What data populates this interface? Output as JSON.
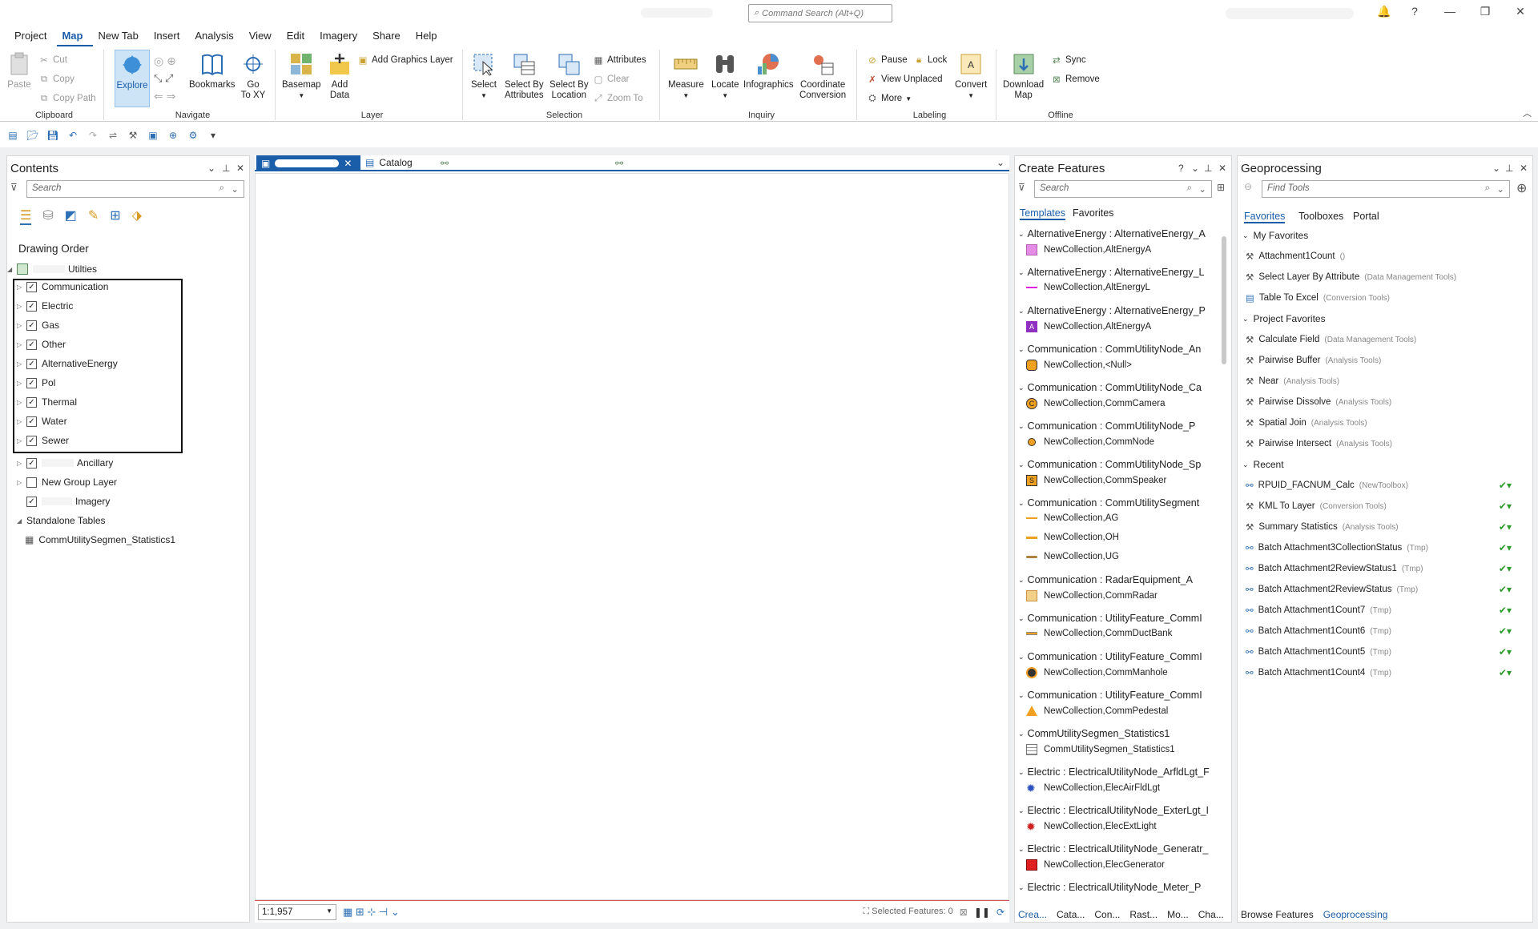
{
  "app": {
    "command_search_placeholder": "Command Search (Alt+Q)"
  },
  "ribbon_tabs": [
    "Project",
    "Map",
    "New Tab",
    "Insert",
    "Analysis",
    "View",
    "Edit",
    "Imagery",
    "Share",
    "Help"
  ],
  "active_tab": "Map",
  "ribbon": {
    "clipboard": {
      "label": "Clipboard",
      "paste": "Paste",
      "cut": "Cut",
      "copy": "Copy",
      "copy_path": "Copy Path"
    },
    "navigate": {
      "label": "Navigate",
      "explore": "Explore",
      "bookmarks": "Bookmarks",
      "go_to_xy": "Go\nTo XY"
    },
    "layer": {
      "label": "Layer",
      "basemap": "Basemap",
      "add_data": "Add\nData",
      "add_graphics_layer": "Add Graphics Layer"
    },
    "selection": {
      "label": "Selection",
      "select": "Select",
      "select_by_attributes": "Select By\nAttributes",
      "select_by_location": "Select By\nLocation",
      "attributes": "Attributes",
      "clear": "Clear",
      "zoom_to": "Zoom To"
    },
    "inquiry": {
      "label": "Inquiry",
      "measure": "Measure",
      "locate": "Locate",
      "infographics": "Infographics",
      "coordinate_conversion": "Coordinate\nConversion"
    },
    "labeling": {
      "label": "Labeling",
      "pause": "Pause",
      "lock": "Lock",
      "view_unplaced": "View Unplaced",
      "more": "More",
      "convert": "Convert"
    },
    "offline": {
      "label": "Offline",
      "download_map": "Download\nMap",
      "sync": "Sync",
      "remove": "Remove"
    }
  },
  "contents": {
    "title": "Contents",
    "search_placeholder": "Search",
    "drawing_order": "Drawing Order",
    "map_layer": "Utilties",
    "groups": [
      {
        "label": "Communication",
        "checked": true
      },
      {
        "label": "Electric",
        "checked": true
      },
      {
        "label": "Gas",
        "checked": true
      },
      {
        "label": "Other",
        "checked": true
      },
      {
        "label": "AlternativeEnergy",
        "checked": true
      },
      {
        "label": "Pol",
        "checked": true
      },
      {
        "label": "Thermal",
        "checked": true
      },
      {
        "label": "Water",
        "checked": true
      },
      {
        "label": "Sewer",
        "checked": true
      }
    ],
    "ancillary": "Ancillary",
    "new_group_layer": "New Group Layer",
    "imagery": "Imagery",
    "standalone_tables": "Standalone Tables",
    "table": "CommUtilitySegmen_Statistics1"
  },
  "map_view": {
    "tabs": [
      "Catalog"
    ],
    "scale": "1:1,957",
    "selected_features": "Selected Features: 0"
  },
  "create_features": {
    "title": "Create Features",
    "search_placeholder": "Search",
    "tabs": [
      "Templates",
      "Favorites"
    ],
    "items": [
      {
        "header": "AlternativeEnergy : AlternativeEnergy_A",
        "subs": [
          {
            "label": "NewCollection,AltEnergyA",
            "sym": "fill-pink"
          }
        ]
      },
      {
        "header": "AlternativeEnergy : AlternativeEnergy_L",
        "subs": [
          {
            "label": "NewCollection,AltEnergyL",
            "sym": "line-magenta"
          }
        ]
      },
      {
        "header": "AlternativeEnergy : AlternativeEnergy_P",
        "subs": [
          {
            "label": "NewCollection,AltEnergyA",
            "sym": "box-purple-a"
          }
        ]
      },
      {
        "header": "Communication : CommUtilityNode_An",
        "subs": [
          {
            "label": "NewCollection,<Null>",
            "sym": "hex-orange"
          }
        ]
      },
      {
        "header": "Communication : CommUtilityNode_Ca",
        "subs": [
          {
            "label": "NewCollection,CommCamera",
            "sym": "circle-c"
          }
        ]
      },
      {
        "header": "Communication : CommUtilityNode_P",
        "subs": [
          {
            "label": "NewCollection,CommNode",
            "sym": "dot-orange"
          }
        ]
      },
      {
        "header": "Communication : CommUtilityNode_Sp",
        "subs": [
          {
            "label": "NewCollection,CommSpeaker",
            "sym": "box-s"
          }
        ]
      },
      {
        "header": "Communication : CommUtilitySegment",
        "subs": [
          {
            "label": "NewCollection,AG",
            "sym": "line-ag"
          },
          {
            "label": "NewCollection,OH",
            "sym": "line-oh"
          },
          {
            "label": "NewCollection,UG",
            "sym": "line-ug"
          }
        ]
      },
      {
        "header": "Communication : RadarEquipment_A",
        "subs": [
          {
            "label": "NewCollection,CommRadar",
            "sym": "fill-tan"
          }
        ]
      },
      {
        "header": "Communication : UtilityFeature_CommI",
        "subs": [
          {
            "label": "NewCollection,CommDuctBank",
            "sym": "line-duct"
          }
        ]
      },
      {
        "header": "Communication : UtilityFeature_CommI",
        "subs": [
          {
            "label": "NewCollection,CommManhole",
            "sym": "circle-dark"
          }
        ]
      },
      {
        "header": "Communication : UtilityFeature_CommI",
        "subs": [
          {
            "label": "NewCollection,CommPedestal",
            "sym": "tri-orange"
          }
        ]
      },
      {
        "header": "CommUtilitySegmen_Statistics1",
        "subs": [
          {
            "label": "CommUtilitySegmen_Statistics1",
            "sym": "table"
          }
        ]
      },
      {
        "header": "Electric : ElectricalUtilityNode_ArfldLgt_F",
        "subs": [
          {
            "label": "NewCollection,ElecAirFldLgt",
            "sym": "star-blue"
          }
        ]
      },
      {
        "header": "Electric : ElectricalUtilityNode_ExterLgt_I",
        "subs": [
          {
            "label": "NewCollection,ElecExtLight",
            "sym": "star-red"
          }
        ]
      },
      {
        "header": "Electric : ElectricalUtilityNode_Generatr_",
        "subs": [
          {
            "label": "NewCollection,ElecGenerator",
            "sym": "fill-red"
          }
        ]
      },
      {
        "header": "Electric : ElectricalUtilityNode_Meter_P",
        "subs": []
      }
    ],
    "bottom_tabs": [
      "Crea...",
      "Cata...",
      "Con...",
      "Rast...",
      "Mo...",
      "Cha..."
    ]
  },
  "geoprocessing": {
    "title": "Geoprocessing",
    "search_placeholder": "Find Tools",
    "tabs": [
      "Favorites",
      "Toolboxes",
      "Portal"
    ],
    "my_favorites_label": "My Favorites",
    "my_favorites": [
      {
        "name": "Attachment1Count",
        "cat": "()"
      },
      {
        "name": "Select Layer By Attribute",
        "cat": "(Data Management Tools)"
      },
      {
        "name": "Table To Excel",
        "cat": "(Conversion Tools)"
      }
    ],
    "project_favorites_label": "Project Favorites",
    "project_favorites": [
      {
        "name": "Calculate Field",
        "cat": "(Data Management Tools)"
      },
      {
        "name": "Pairwise Buffer",
        "cat": "(Analysis Tools)"
      },
      {
        "name": "Near",
        "cat": "(Analysis Tools)"
      },
      {
        "name": "Pairwise Dissolve",
        "cat": "(Analysis Tools)"
      },
      {
        "name": "Spatial Join",
        "cat": "(Analysis Tools)"
      },
      {
        "name": "Pairwise Intersect",
        "cat": "(Analysis Tools)"
      }
    ],
    "recent_label": "Recent",
    "recent": [
      {
        "name": "RPUID_FACNUM_Calc",
        "cat": "(NewToolbox)"
      },
      {
        "name": "KML To Layer",
        "cat": "(Conversion Tools)"
      },
      {
        "name": "Summary Statistics",
        "cat": "(Analysis Tools)"
      },
      {
        "name": "Batch Attachment3CollectionStatus",
        "cat": "(Tmp)"
      },
      {
        "name": "Batch Attachment2ReviewStatus1",
        "cat": "(Tmp)"
      },
      {
        "name": "Batch Attachment2ReviewStatus",
        "cat": "(Tmp)"
      },
      {
        "name": "Batch Attachment1Count7",
        "cat": "(Tmp)"
      },
      {
        "name": "Batch Attachment1Count6",
        "cat": "(Tmp)"
      },
      {
        "name": "Batch Attachment1Count5",
        "cat": "(Tmp)"
      },
      {
        "name": "Batch Attachment1Count4",
        "cat": "(Tmp)"
      }
    ],
    "bottom_tabs": [
      "Browse Features",
      "Geoprocessing"
    ]
  }
}
